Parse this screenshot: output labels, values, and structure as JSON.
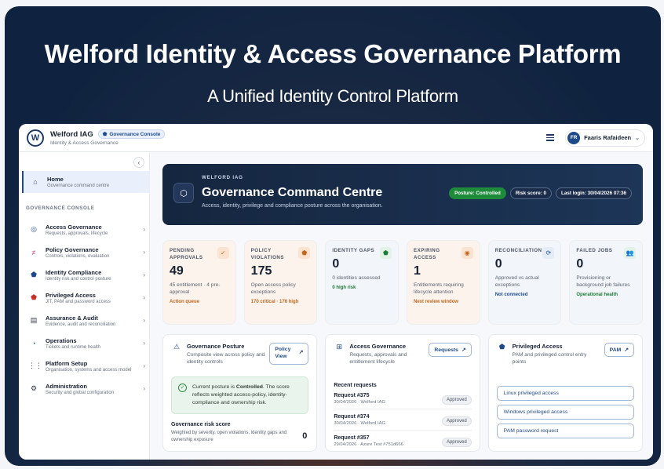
{
  "hero": {
    "title": "Welford Identity & Access Governance Platform",
    "subtitle": "A Unified Identity Control Platform"
  },
  "topbar": {
    "logo_letter": "W",
    "brand_name": "Welford IAG",
    "brand_sub": "Identity & Access Governance",
    "console_badge": "Governance Console",
    "user_initials": "FR",
    "user_name": "Faaris Rafaideen"
  },
  "sidebar": {
    "home": {
      "label": "Home",
      "sub": "Governance command centre"
    },
    "section_heading": "GOVERNANCE CONSOLE",
    "items": [
      {
        "label": "Access Governance",
        "sub": "Requests, approvals, lifecycle",
        "icon": "shield-icon",
        "glyph": "◎",
        "color": "#1f4a8a"
      },
      {
        "label": "Policy Governance",
        "sub": "Controls, violations, evaluation",
        "icon": "policy-icon",
        "glyph": "≠",
        "color": "#c2417a"
      },
      {
        "label": "Identity Compliance",
        "sub": "Identity risk and control posture",
        "icon": "shield-check-icon",
        "glyph": "⬟",
        "color": "#1f4a8a"
      },
      {
        "label": "Privileged Access",
        "sub": "JIT, PAM and password access",
        "icon": "privileged-shield-icon",
        "glyph": "⬟",
        "color": "#c83030"
      },
      {
        "label": "Assurance & Audit",
        "sub": "Evidence, audit and reconciliation",
        "icon": "audit-icon",
        "glyph": "▤",
        "color": "#2f3a4c"
      },
      {
        "label": "Operations",
        "sub": "Tickets and runtime health",
        "icon": "operations-icon",
        "glyph": "◔",
        "color": "#1f6aa8"
      },
      {
        "label": "Platform Setup",
        "sub": "Organisation, systems and access model",
        "icon": "grid-icon",
        "glyph": "⋮⋮",
        "color": "#2f3a4c"
      },
      {
        "label": "Administration",
        "sub": "Security and global configuration",
        "icon": "gear-icon",
        "glyph": "⚙",
        "color": "#2f3a4c"
      }
    ]
  },
  "command": {
    "small": "WELFORD IAG",
    "title": "Governance Command Centre",
    "desc": "Access, identity, privilege and compliance posture across the organisation.",
    "pills": [
      "Posture: Controlled",
      "Risk score: 0",
      "Last login: 30/04/2026 07:36"
    ]
  },
  "stats": [
    {
      "label": "PENDING APPROVALS",
      "value": "49",
      "desc": "45 entitlement · 4 pre-approval",
      "note": "Action queue",
      "note_color": "#c0661e",
      "tone": "warm",
      "icon": "approval-check-icon",
      "glyph": "✓",
      "icon_bg": "#fbe3d0",
      "icon_color": "#c0661e"
    },
    {
      "label": "POLICY VIOLATIONS",
      "value": "175",
      "desc": "Open access policy exceptions",
      "note": "170 critical · 176 high",
      "note_color": "#c0661e",
      "tone": "warm",
      "icon": "policy-shield-icon",
      "glyph": "⬟",
      "icon_bg": "#fbe3d0",
      "icon_color": "#c0661e"
    },
    {
      "label": "IDENTITY GAPS",
      "value": "0",
      "desc": "0 identities assessed",
      "note": "0 high risk",
      "note_color": "#1e7a36",
      "tone": "cool",
      "icon": "identity-shield-icon",
      "glyph": "⬟",
      "icon_bg": "#e2f2e6",
      "icon_color": "#1e7a36"
    },
    {
      "label": "EXPIRING ACCESS",
      "value": "1",
      "desc": "Entitlements requiring lifecycle attention",
      "note": "Next review window",
      "note_color": "#c0661e",
      "tone": "warm",
      "icon": "eye-icon",
      "glyph": "◉",
      "icon_bg": "#fbe3d0",
      "icon_color": "#c0661e"
    },
    {
      "label": "RECONCILIATION",
      "value": "0",
      "desc": "Approved vs actual exceptions",
      "note": "Not connected",
      "note_color": "#1f4a8a",
      "tone": "cool",
      "icon": "sync-icon",
      "glyph": "⟳",
      "icon_bg": "#e4ecf8",
      "icon_color": "#1f4a8a"
    },
    {
      "label": "FAILED JOBS",
      "value": "0",
      "desc": "Provisioning or background job failures",
      "note": "Operational health",
      "note_color": "#1e7a36",
      "tone": "cool",
      "icon": "users-icon",
      "glyph": "👥",
      "icon_bg": "#e2f2e6",
      "icon_color": "#1e7a36"
    }
  ],
  "posture": {
    "title": "Governance Posture",
    "desc": "Composite view across policy and identity controls",
    "button": "Policy View",
    "status_pre": "Current posture is ",
    "status_value": "Controlled",
    "status_post": ". The score reflects weighted access-policy, identity-compliance and ownership risk.",
    "risk_title": "Governance risk score",
    "risk_desc": "Weighted by severity, open violations, identity gaps and ownership exposure",
    "risk_value": "0"
  },
  "access": {
    "title": "Access Governance",
    "desc": "Requests, approvals and entitlement lifecycle",
    "button": "Requests",
    "recent_heading": "Recent requests",
    "requests": [
      {
        "title": "Request #375",
        "sub": "30/04/2026 · Welford IAG",
        "status": "Approved"
      },
      {
        "title": "Request #374",
        "sub": "30/04/2026 · Welford IAG",
        "status": "Approved"
      },
      {
        "title": "Request #357",
        "sub": "29/04/2026 · Azure Test #751d666",
        "status": "Approved"
      }
    ]
  },
  "privileged": {
    "title": "Privileged Access",
    "desc": "PAM and privileged control entry points",
    "button": "PAM",
    "links": [
      "Linux privileged access",
      "Windows privileged access",
      "PAM password request"
    ]
  }
}
